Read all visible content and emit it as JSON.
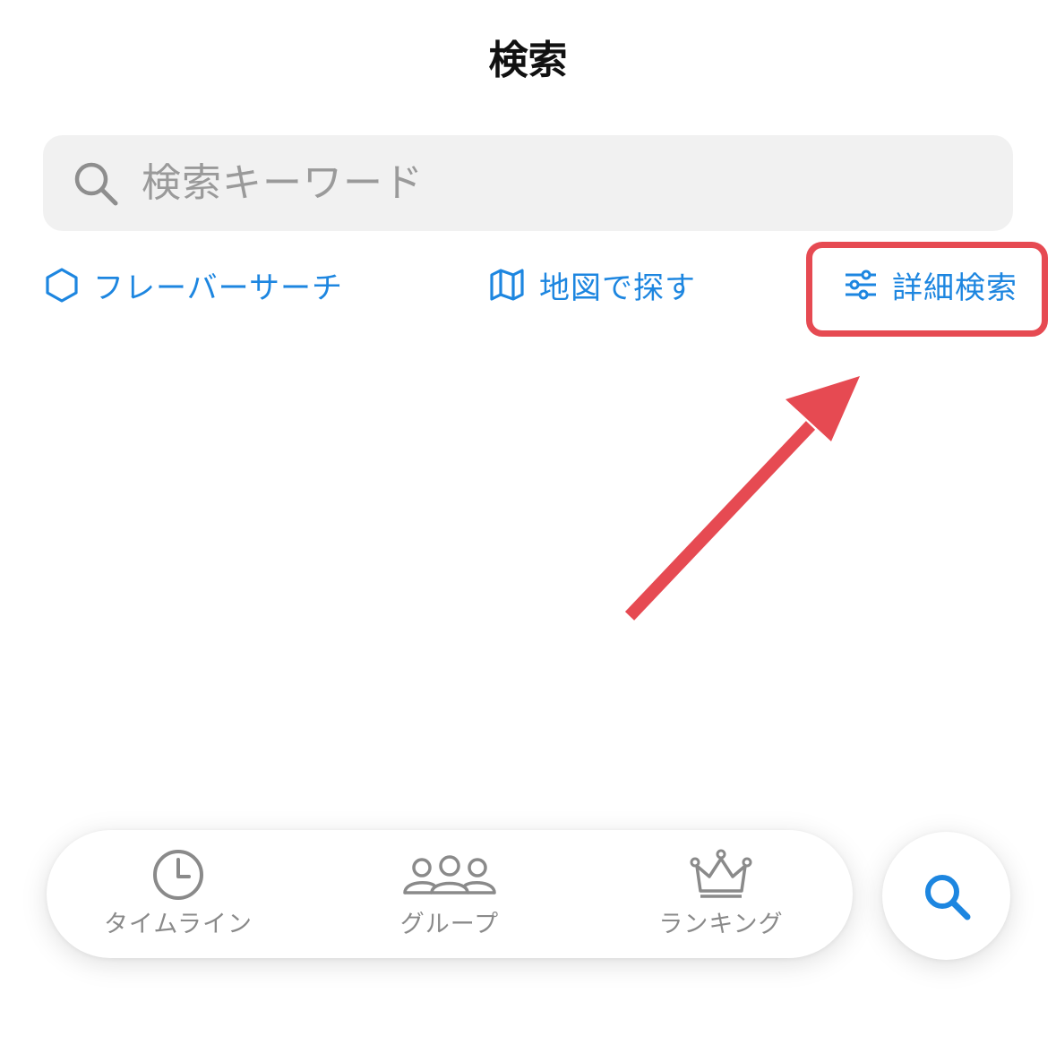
{
  "header": {
    "title": "検索"
  },
  "search": {
    "placeholder": "検索キーワード",
    "icon": "magnifier-icon"
  },
  "quick_links": [
    {
      "label": "フレーバーサーチ",
      "icon": "hexagon-icon"
    },
    {
      "label": "地図で探す",
      "icon": "map-icon"
    },
    {
      "label": "詳細検索",
      "icon": "sliders-icon"
    }
  ],
  "annotation": {
    "highlight_color": "#e64a52",
    "target": "詳細検索"
  },
  "tabbar": {
    "items": [
      {
        "label": "タイムライン",
        "icon": "clock-icon"
      },
      {
        "label": "グループ",
        "icon": "group-icon"
      },
      {
        "label": "ランキング",
        "icon": "crown-icon"
      }
    ],
    "active_button_icon": "search-icon"
  },
  "colors": {
    "accent": "#1d86e0",
    "inactive": "#8a8a8a",
    "search_bg": "#f1f1f1",
    "annotation": "#e64a52"
  }
}
